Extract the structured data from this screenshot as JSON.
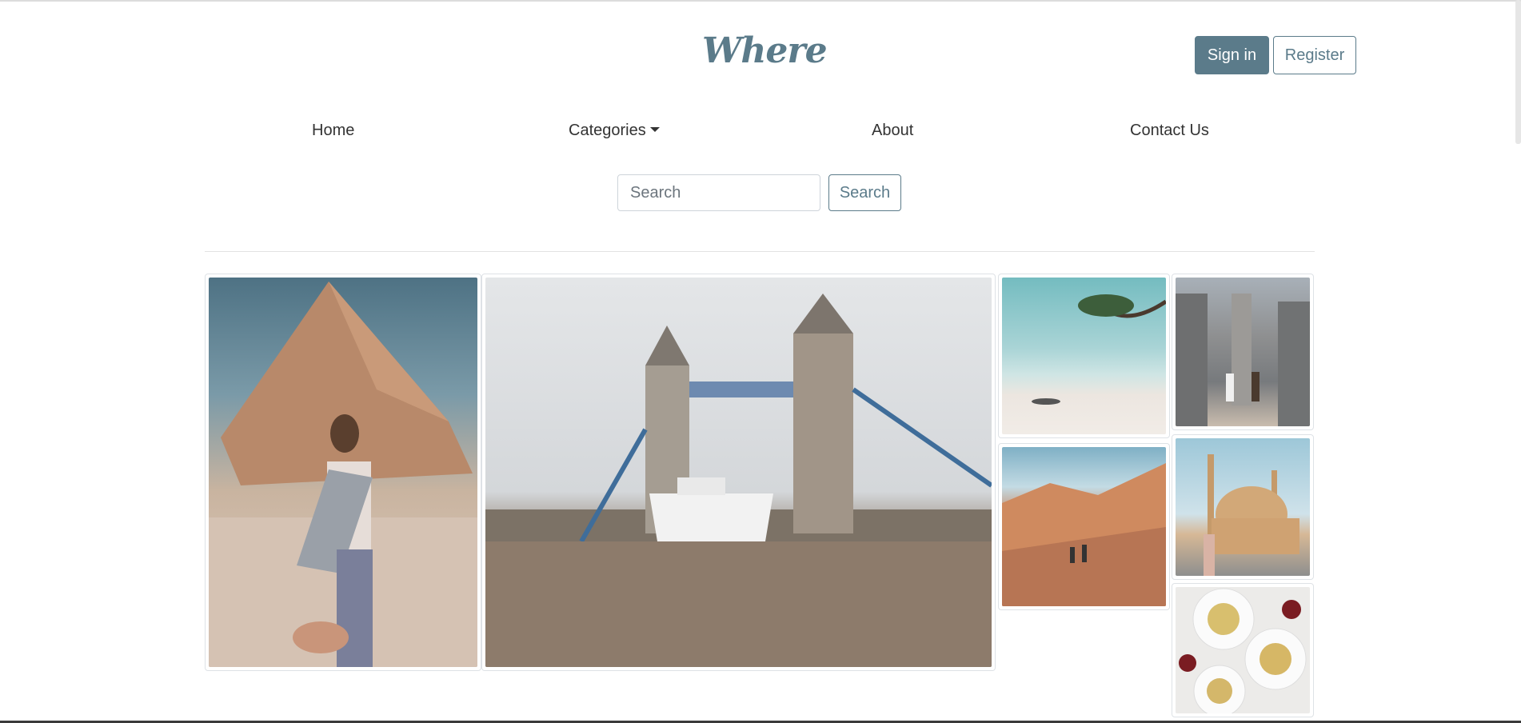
{
  "header": {
    "logo_text": "Where",
    "sign_in_label": "Sign in",
    "register_label": "Register"
  },
  "nav": {
    "items": [
      {
        "label": "Home"
      },
      {
        "label": "Categories"
      },
      {
        "label": "About"
      },
      {
        "label": "Contact Us"
      }
    ]
  },
  "search": {
    "placeholder": "Search",
    "value": "",
    "button_label": "Search"
  },
  "gallery": {
    "images": [
      {
        "name": "pyramid-woman-photo"
      },
      {
        "name": "tower-bridge-photo"
      },
      {
        "name": "palm-beach-photo"
      },
      {
        "name": "canyon-couple-photo"
      },
      {
        "name": "temple-couple-photo"
      },
      {
        "name": "mosque-woman-photo"
      },
      {
        "name": "pasta-dinner-photo"
      }
    ]
  },
  "colors": {
    "brand": "#5b7b8a",
    "text": "#333333",
    "border": "#dee2e6"
  }
}
